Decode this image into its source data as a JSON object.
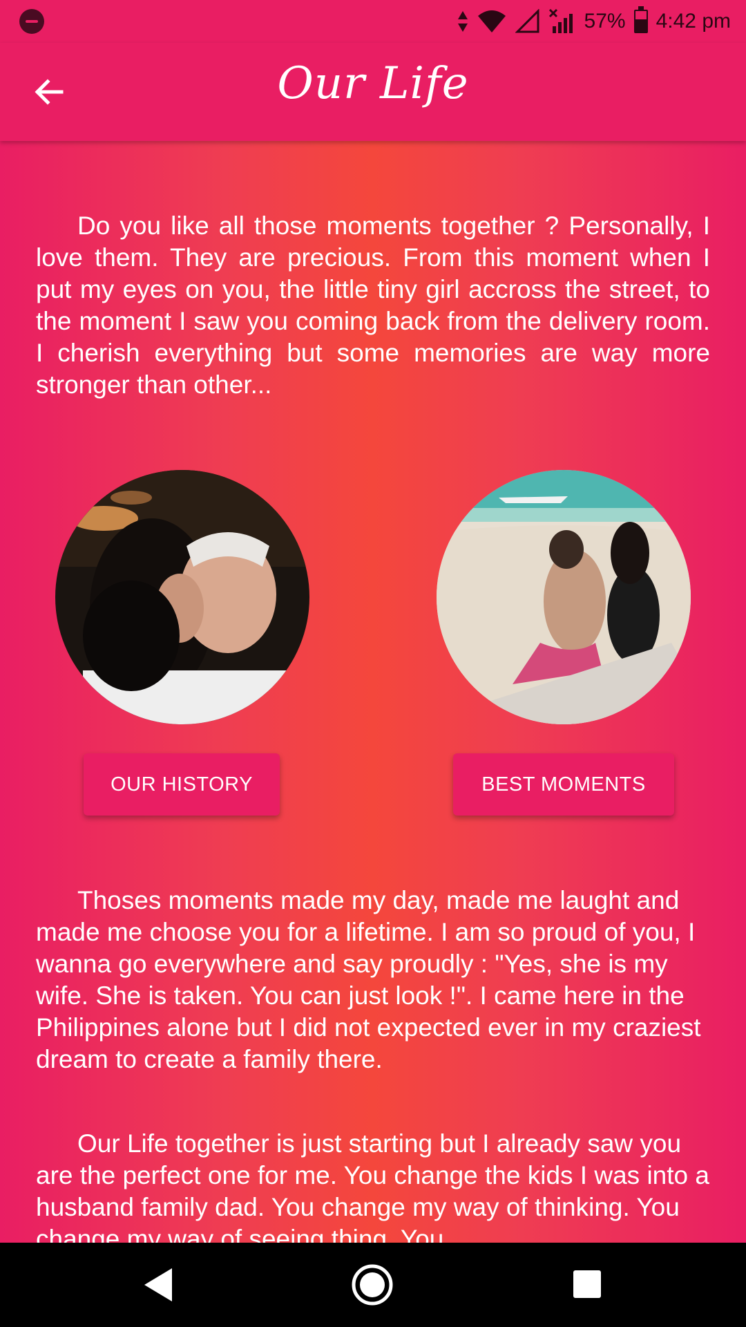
{
  "status_bar": {
    "battery_percent": "57%",
    "time": "4:42 pm",
    "icons": [
      "dnd-icon",
      "data-arrows-icon",
      "wifi-icon",
      "signal-empty-icon",
      "signal-no-sim-icon",
      "battery-icon"
    ]
  },
  "app_bar": {
    "title": "Our Life",
    "back_icon": "arrow-left-icon"
  },
  "main": {
    "paragraph_1": "Do you like all those moments together ? Personally, I love them. They are precious. From this moment when I put my eyes on you, the little tiny girl accross the street, to the moment I saw you coming back from the delivery room. I cherish everything but some memories are way more stronger than other...",
    "paragraph_2": "Thoses moments made my day, made me laught and made me choose you for a lifetime. I am so proud of you, I wanna go everywhere and say proudly : \"Yes, she is my wife. She is taken. You can just look !\". I came here in the Philippines alone but I did not expected ever in my craziest dream to create a family there.",
    "paragraph_3": "Our Life together is just starting but I already saw you are the perfect one for me. You change the kids I was into a husband family dad. You change my way of thinking. You change my way of seeing thing. You",
    "buttons": {
      "history_label": "OUR HISTORY",
      "moments_label": "BEST MOMENTS"
    }
  },
  "nav_bar": {
    "icons": [
      "nav-back-icon",
      "nav-home-icon",
      "nav-recents-icon"
    ]
  },
  "colors": {
    "primary": "#e91e63",
    "gradient_center": "#f4473c",
    "text": "#ffffff"
  }
}
